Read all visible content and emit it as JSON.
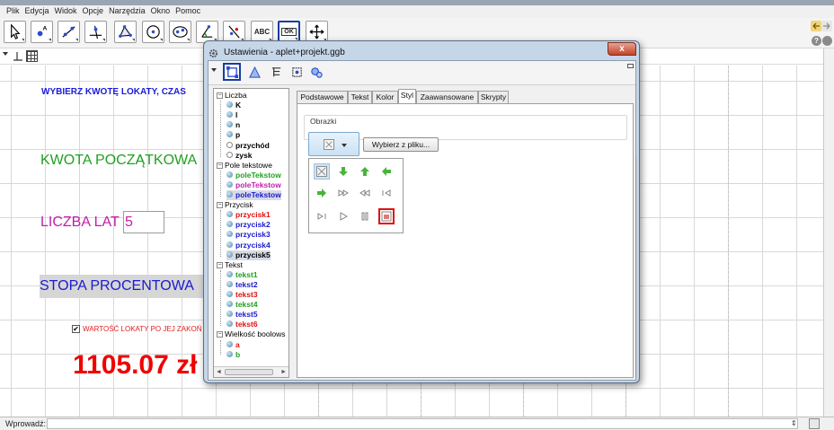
{
  "menu": [
    "Plik",
    "Edycja",
    "Widok",
    "Opcje",
    "Narzędzia",
    "Okno",
    "Pomoc"
  ],
  "toolbar": {
    "tools": [
      {
        "name": "move-tool",
        "icon": "arrow-icon"
      },
      {
        "name": "point-tool",
        "icon": "point-icon"
      },
      {
        "name": "line-tool",
        "icon": "line-icon"
      },
      {
        "name": "perpendicular-tool",
        "icon": "perpendicular-icon"
      },
      {
        "name": "polygon-tool",
        "icon": "polygon-icon"
      },
      {
        "name": "circle-tool",
        "icon": "circle-icon"
      },
      {
        "name": "ellipse-tool",
        "icon": "ellipse-icon"
      },
      {
        "name": "angle-tool",
        "icon": "angle-icon"
      },
      {
        "name": "reflect-tool",
        "icon": "reflect-icon"
      },
      {
        "name": "text-tool",
        "icon": "text-icon",
        "label": "ABC"
      },
      {
        "name": "button-tool",
        "icon": "button-icon",
        "label": "OK"
      },
      {
        "name": "move-view-tool",
        "icon": "move-view-icon"
      }
    ],
    "help_label": "?"
  },
  "graphics": {
    "title": "WYBIERZ KWOTĘ LOKATY, CZAS",
    "kwota_label": "KWOTA POCZĄTKOWA",
    "lat_label": "LICZBA LAT",
    "lat_value": "5",
    "stopa_label": "STOPA PROCENTOWA",
    "checkbox_mark": "✔",
    "wartosc_label": "WARTOŚĆ LOKATY PO JEJ ZAKOŃ",
    "result": "1105.07 zł"
  },
  "inputbar": {
    "label": "Wprowadź:",
    "value": ""
  },
  "dialog": {
    "title": "Ustawienia - aplet+projekt.ggb",
    "close_label": "x",
    "tree": [
      {
        "type": "group",
        "label": "Liczba"
      },
      {
        "type": "item",
        "label": "K",
        "color": "#000000",
        "dot": "filled"
      },
      {
        "type": "item",
        "label": "l",
        "color": "#000000",
        "dot": "filled"
      },
      {
        "type": "item",
        "label": "n",
        "color": "#000000",
        "dot": "filled"
      },
      {
        "type": "item",
        "label": "p",
        "color": "#000000",
        "dot": "filled"
      },
      {
        "type": "item",
        "label": "przychód",
        "color": "#000000",
        "dot": "empty"
      },
      {
        "type": "item",
        "label": "zysk",
        "color": "#000000",
        "dot": "empty"
      },
      {
        "type": "group",
        "label": "Pole tekstowe"
      },
      {
        "type": "item",
        "label": "poleTekstow",
        "color": "#1fa11f",
        "dot": "filled"
      },
      {
        "type": "item",
        "label": "poleTekstow",
        "color": "#c11fa8",
        "dot": "filled"
      },
      {
        "type": "item",
        "label": "poleTekstow",
        "color": "#1a1ad0",
        "dot": "filled",
        "selected": true
      },
      {
        "type": "group",
        "label": "Przycisk"
      },
      {
        "type": "item",
        "label": "przycisk1",
        "color": "#e01010",
        "dot": "filled"
      },
      {
        "type": "item",
        "label": "przycisk2",
        "color": "#1a1ad0",
        "dot": "filled"
      },
      {
        "type": "item",
        "label": "przycisk3",
        "color": "#1a1ad0",
        "dot": "filled"
      },
      {
        "type": "item",
        "label": "przycisk4",
        "color": "#1a1ad0",
        "dot": "filled"
      },
      {
        "type": "item",
        "label": "przycisk5",
        "color": "#000000",
        "dot": "filled",
        "selected": true
      },
      {
        "type": "group",
        "label": "Tekst"
      },
      {
        "type": "item",
        "label": "tekst1",
        "color": "#1fa11f",
        "dot": "filled"
      },
      {
        "type": "item",
        "label": "tekst2",
        "color": "#1a1ad0",
        "dot": "filled"
      },
      {
        "type": "item",
        "label": "tekst3",
        "color": "#e01010",
        "dot": "filled"
      },
      {
        "type": "item",
        "label": "tekst4",
        "color": "#1fa11f",
        "dot": "filled"
      },
      {
        "type": "item",
        "label": "tekst5",
        "color": "#1a1ad0",
        "dot": "filled"
      },
      {
        "type": "item",
        "label": "tekst6",
        "color": "#e01010",
        "dot": "filled"
      },
      {
        "type": "group",
        "label": "Wielkość boolows"
      },
      {
        "type": "item",
        "label": "a",
        "color": "#e01010",
        "dot": "filled"
      },
      {
        "type": "item",
        "label": "b",
        "color": "#1fa11f",
        "dot": "filled"
      }
    ],
    "tabs": [
      "Podstawowe",
      "Tekst",
      "Kolor",
      "Styl",
      "Zaawansowane",
      "Skrypty"
    ],
    "active_tab": "Styl",
    "group_label": "Obrazki",
    "file_button": "Wybierz z pliku...",
    "scroll_left": "◄",
    "scroll_right": "►"
  }
}
